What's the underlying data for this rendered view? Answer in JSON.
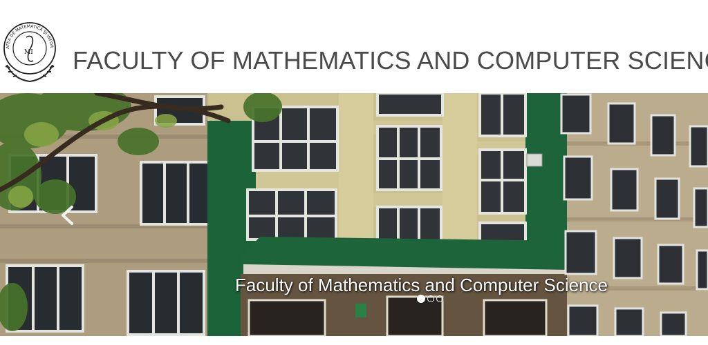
{
  "header": {
    "logo": {
      "icon": "faculty-seal-logo",
      "ring_text": "FACULTATEA DE MATEMATICĂ ŞI INFORMATICĂ",
      "center_text": "MI"
    },
    "title": "FACULTY OF MATHEMATICS AND COMPUTER SCIENCE"
  },
  "carousel": {
    "caption": "Faculty of Mathematics and Computer Science",
    "prev_icon": "chevron-left-icon",
    "slides_count": 3,
    "active_slide": 1,
    "colors": {
      "wall": "#c9b79a",
      "green_trim": "#1f6b3f",
      "cream_panel": "#e6dba7"
    }
  }
}
